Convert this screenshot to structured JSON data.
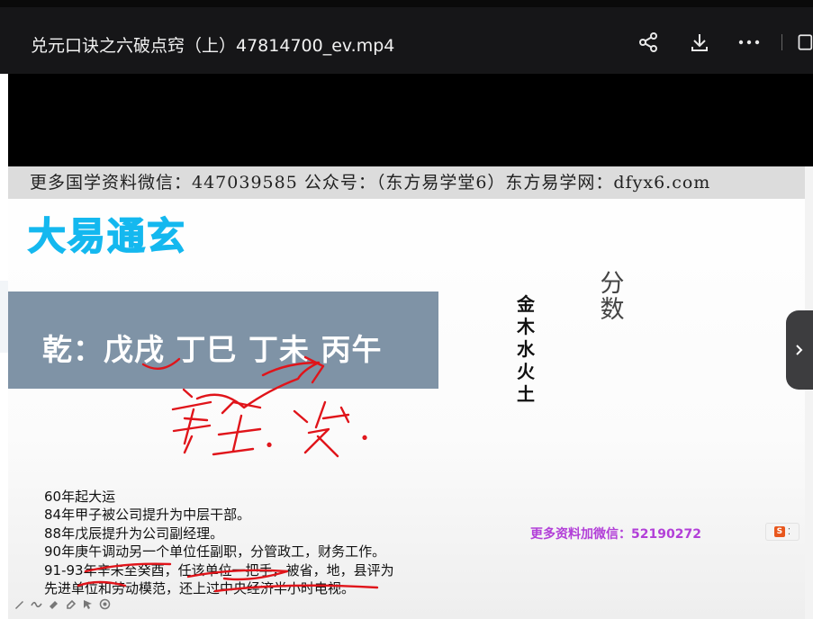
{
  "window": {
    "title": "兑元口诀之六破点窍（上）47814700_ev.mp4",
    "actions": [
      {
        "name": "share",
        "icon": "share-icon"
      },
      {
        "name": "download",
        "icon": "download-icon"
      },
      {
        "name": "more",
        "icon": "more-icon"
      }
    ]
  },
  "slide": {
    "banner": "更多国学资料微信：447039585 公众号：（东方易学堂6）东方易学网：dfyx6.com",
    "logo": "大易通玄",
    "qian": "乾：戊戌 丁巳 丁未 丙午",
    "elements": [
      "金",
      "木",
      "水",
      "火",
      "土"
    ],
    "fenshu": [
      "分",
      "数"
    ],
    "notes": [
      "60年起大运",
      "84年甲子被公司提升为中层干部。",
      "88年戊辰提升为公司副经理。",
      "90年庚午调动另一个单位任副职，分管政工，财务工作。",
      "91-93年辛未至癸酉，任该单位一把手，被省，地，县评为",
      "先进单位和劳动模范，还上过中央经济半小时电视。"
    ],
    "wechat": "更多资料加微信：52190272",
    "annotation_color": "#e0141a",
    "logo_color": "#14b8ef"
  },
  "player": {
    "next_icon": "chevron-right-icon"
  }
}
